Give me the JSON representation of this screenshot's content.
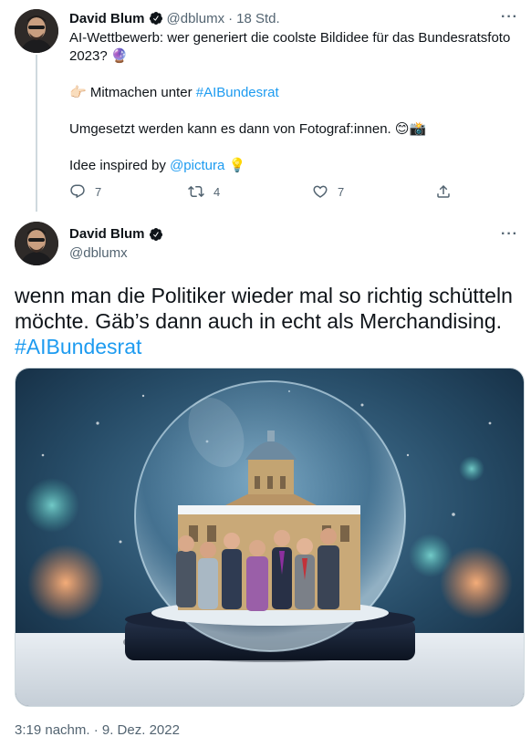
{
  "tweet1": {
    "author_name": "David Blum",
    "handle": "@dblumx",
    "separator": "·",
    "time": "18 Std.",
    "line1": "AI-Wettbewerb: wer generiert die coolste Bildidee für das Bundesratsfoto 2023? 🔮",
    "line2_prefix": "👉🏻 Mitmachen unter ",
    "line2_hashtag": "#AIBundesrat",
    "line3": "Umgesetzt werden kann es dann von Fotograf:innen. 😊📸",
    "line4_prefix": "Idee inspired by ",
    "line4_mention": "@pictura",
    "line4_suffix": " 💡",
    "replies": "7",
    "retweets": "4",
    "likes": "7"
  },
  "tweet2": {
    "author_name": "David Blum",
    "handle": "@dblumx",
    "text": "wenn man die Politiker wieder mal so richtig schütteln möchte. Gäb’s dann auch in echt als Merchandising. ",
    "hashtag": "#AIBundesrat",
    "timestamp": "3:19 nachm. · 9. Dez. 2022"
  },
  "icons": {
    "more": "more-icon",
    "verified": "verified-icon",
    "reply": "reply-icon",
    "retweet": "retweet-icon",
    "like": "like-icon",
    "share": "share-icon"
  },
  "colors": {
    "link": "#1d9bf0",
    "secondary_text": "#536471",
    "primary_text": "#0f1419"
  }
}
